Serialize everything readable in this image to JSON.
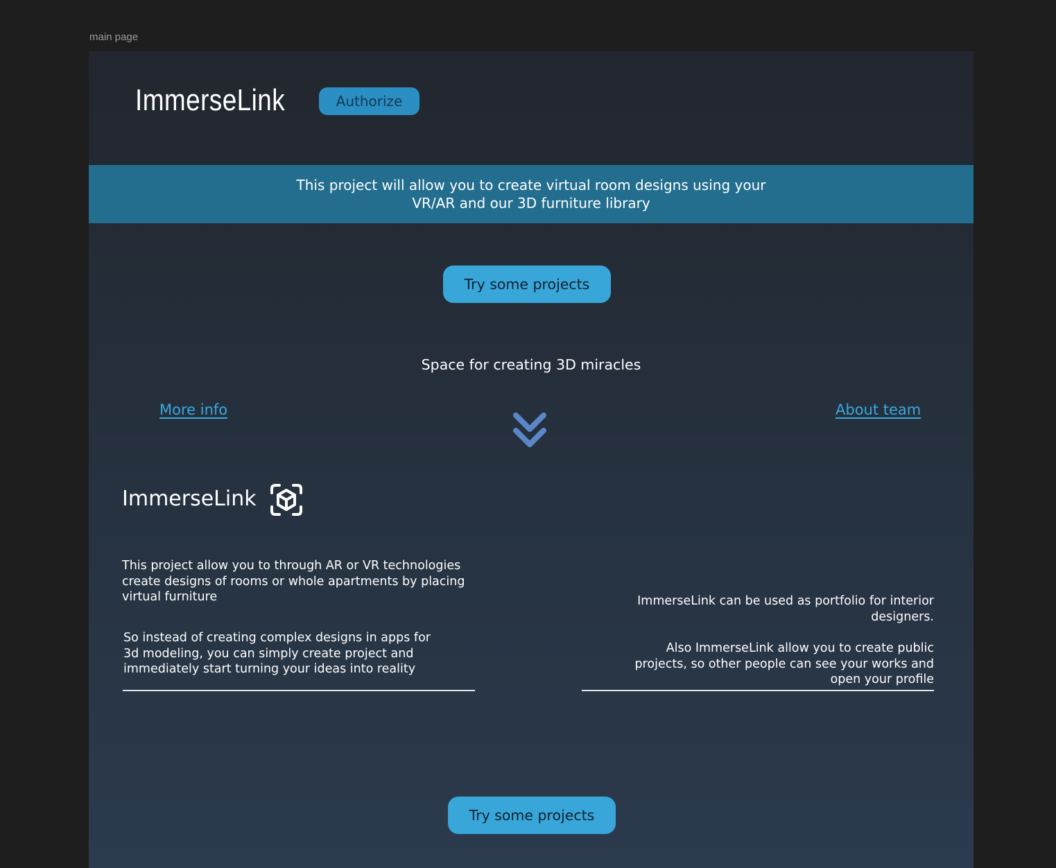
{
  "frame": {
    "label": "main page"
  },
  "header": {
    "brand": "ImmerseLink",
    "authorize_label": "Authorize"
  },
  "banner": {
    "text": "This project will allow you to create virtual room designs using your\nVR/AR and our 3D furniture library"
  },
  "hero": {
    "cta_label": "Try some projects",
    "tagline": "Space for creating 3D miracles",
    "more_info_label": "More info",
    "about_team_label": "About team",
    "scroll_icon": "double-chevron-down-icon"
  },
  "about": {
    "brand": "ImmerseLink",
    "brand_icon": "ar-cube-icon",
    "left_paragraphs": [
      "This project allow you to through AR or VR technologies create designs of rooms or whole apartments by placing virtual furniture",
      "So instead of creating complex designs in apps for 3d modeling, you can simply create project and immediately start turning your ideas into reality"
    ],
    "right_paragraphs": [
      "ImmerseLink can be used as portfolio for interior designers.",
      "Also ImmerseLink allow you to create public projects, so other people can see your works and open your profile"
    ]
  },
  "footer": {
    "cta_label": "Try some projects"
  },
  "colors": {
    "page_background": "#1e1e1e",
    "frame_top": "#22262e",
    "frame_bottom": "#2b3a4d",
    "banner": "#236e8f",
    "accent": "#39a6da",
    "authorize": "#2c8fc4",
    "link": "#3aa8df",
    "chevron": "#5b86c8"
  }
}
